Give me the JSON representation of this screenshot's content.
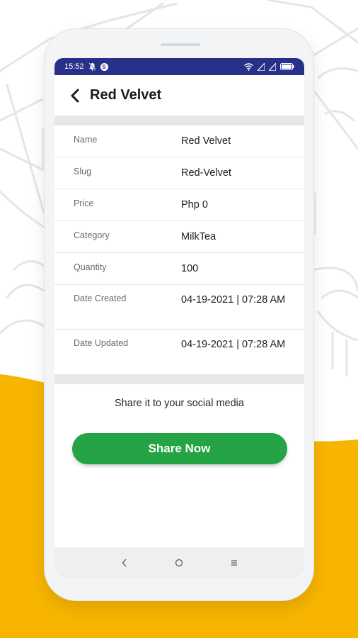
{
  "colors": {
    "status_bar": "#28318a",
    "accent_yellow": "#f7b500",
    "share_button": "#24a444",
    "divider": "#e6e7e9"
  },
  "status_bar": {
    "time": "15:52",
    "left_icons": [
      "mute-notification-icon",
      "s-badge-icon"
    ],
    "right_icons": [
      "wifi-icon",
      "signal-icon",
      "signal-icon",
      "battery-icon"
    ]
  },
  "header": {
    "back_icon": "chevron-left-icon",
    "title": "Red Velvet"
  },
  "details": [
    {
      "label": "Name",
      "value": "Red Velvet"
    },
    {
      "label": "Slug",
      "value": "Red-Velvet"
    },
    {
      "label": "Price",
      "value": "Php 0"
    },
    {
      "label": "Category",
      "value": "MilkTea"
    },
    {
      "label": "Quantity",
      "value": "100"
    },
    {
      "label": "Date Created",
      "value": "04-19-2021 | 07:28 AM"
    },
    {
      "label": "Date Updated",
      "value": "04-19-2021 | 07:28 AM"
    }
  ],
  "share": {
    "prompt": "Share it to your social media",
    "button_label": "Share Now"
  },
  "nav_bar": {
    "icons": [
      "back-nav-icon",
      "home-nav-icon",
      "recents-nav-icon"
    ]
  }
}
